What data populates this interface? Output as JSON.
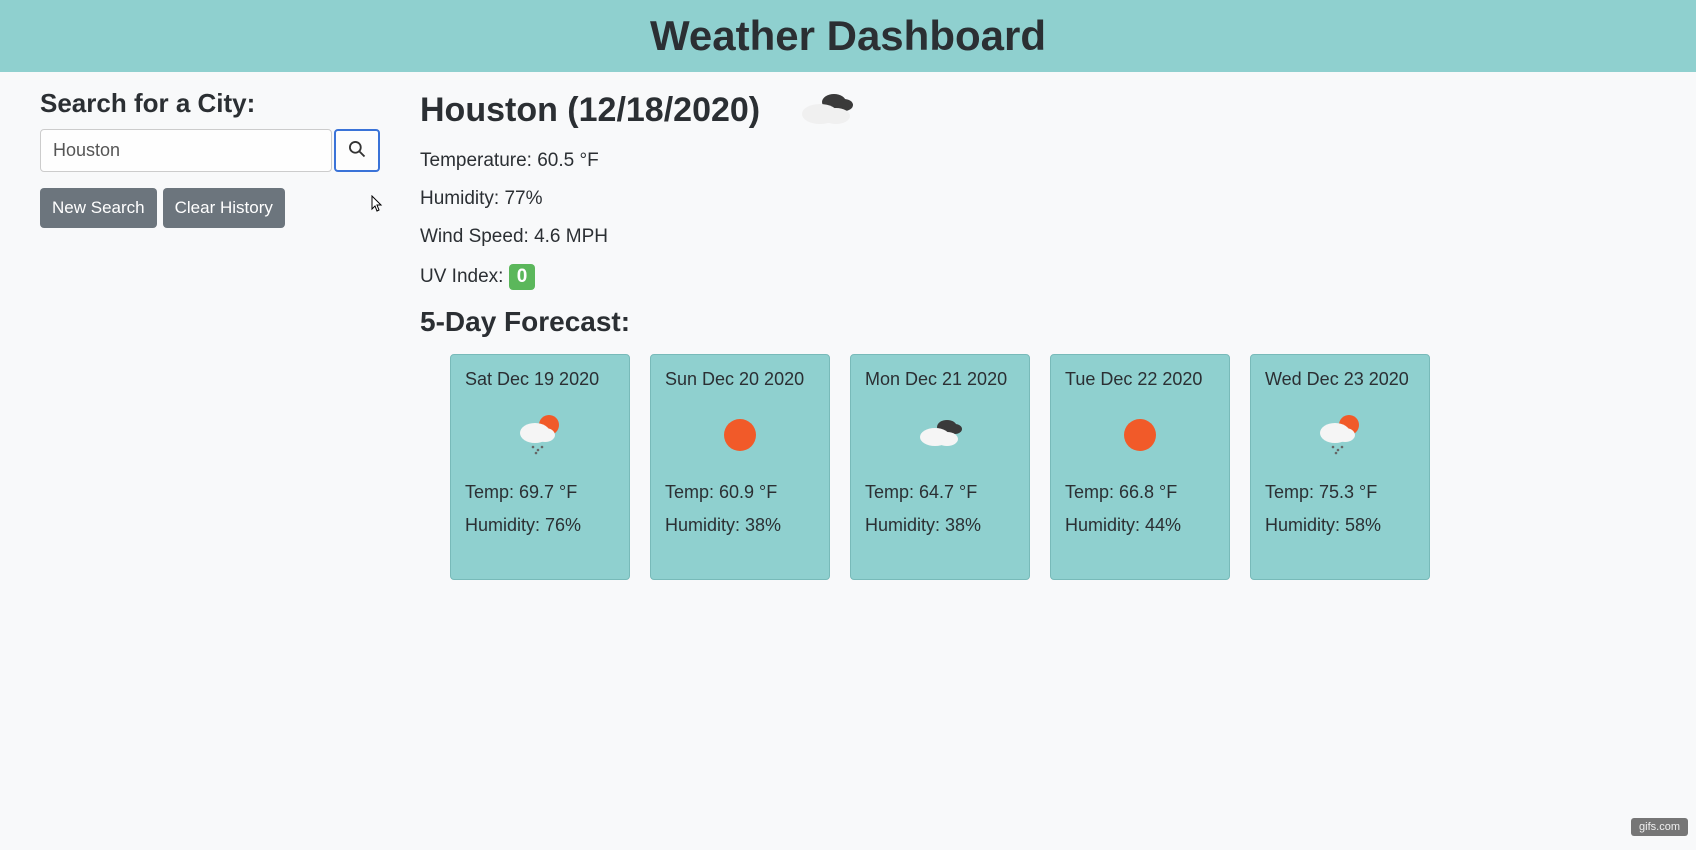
{
  "header": {
    "title": "Weather Dashboard"
  },
  "sidebar": {
    "heading": "Search for a City:",
    "search_value": "Houston",
    "new_search_label": "New Search",
    "clear_history_label": "Clear History"
  },
  "current": {
    "city_label": "Houston (12/18/2020)",
    "temperature_label": "Temperature: 60.5 °F",
    "humidity_label": "Humidity: 77%",
    "wind_label": "Wind Speed: 4.6 MPH",
    "uv_prefix": "UV Index: ",
    "uv_value": "0",
    "icon": "overcast"
  },
  "forecast": {
    "title": "5-Day Forecast:",
    "days": [
      {
        "date": "Sat Dec 19 2020",
        "icon": "partly-showers",
        "temp": "Temp: 69.7 °F",
        "humidity": "Humidity: 76%"
      },
      {
        "date": "Sun Dec 20 2020",
        "icon": "sunny",
        "temp": "Temp: 60.9 °F",
        "humidity": "Humidity: 38%"
      },
      {
        "date": "Mon Dec 21 2020",
        "icon": "cloudy",
        "temp": "Temp: 64.7 °F",
        "humidity": "Humidity: 38%"
      },
      {
        "date": "Tue Dec 22 2020",
        "icon": "sunny",
        "temp": "Temp: 66.8 °F",
        "humidity": "Humidity: 44%"
      },
      {
        "date": "Wed Dec 23 2020",
        "icon": "partly-showers",
        "temp": "Temp: 75.3 °F",
        "humidity": "Humidity: 58%"
      }
    ]
  },
  "watermark": "gifs.com"
}
